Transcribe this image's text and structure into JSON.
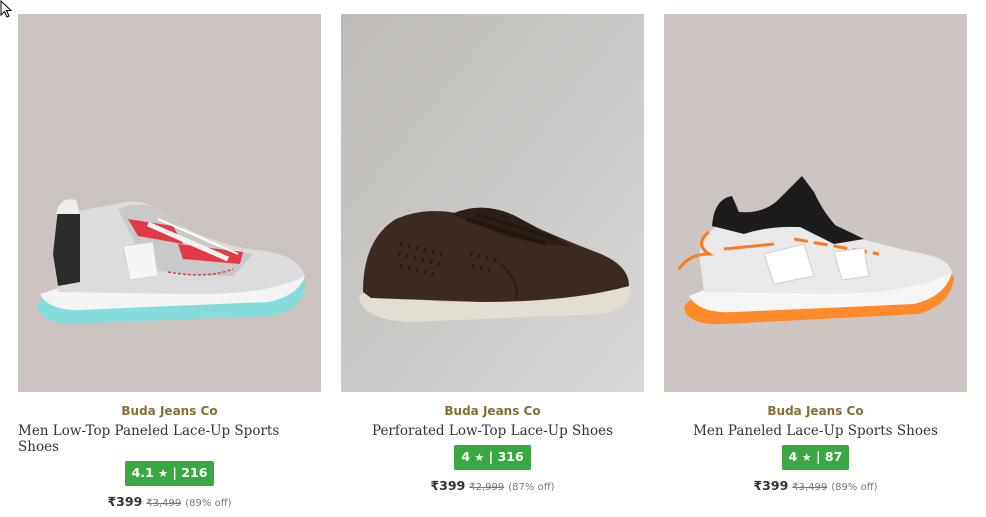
{
  "products": [
    {
      "brand": "Buda Jeans Co",
      "name": "Men Low-Top Paneled Lace-Up Sports Shoes",
      "rating": "4.1",
      "star": "★",
      "rating_count": "216",
      "price": "₹399",
      "mrp": "₹3,499",
      "discount": "(89% off)",
      "image_bg": "#c9c2be",
      "shoe_colors": {
        "body": "#e7e7e7",
        "accent": "#e03a44",
        "sole": "#7ad8d8",
        "dark": "#222222"
      }
    },
    {
      "brand": "Buda Jeans Co",
      "name": "Perforated Low-Top Lace-Up Shoes",
      "rating": "4",
      "star": "★",
      "rating_count": "316",
      "price": "₹399",
      "mrp": "₹2,999",
      "discount": "(87% off)",
      "image_bg": "#b9b7b5",
      "shoe_colors": {
        "body": "#3b2a22",
        "accent": "#2e211b",
        "sole": "#e2ddd2",
        "dark": "#241913"
      }
    },
    {
      "brand": "Buda Jeans Co",
      "name": "Men Paneled Lace-Up Sports Shoes",
      "rating": "4",
      "star": "★",
      "rating_count": "87",
      "price": "₹399",
      "mrp": "₹3,499",
      "discount": "(89% off)",
      "image_bg": "#cbc4c1",
      "shoe_colors": {
        "body": "#eeeeee",
        "accent": "#ff7a1f",
        "sole": "#ff8a2a",
        "dark": "#1b1b1b"
      }
    }
  ]
}
